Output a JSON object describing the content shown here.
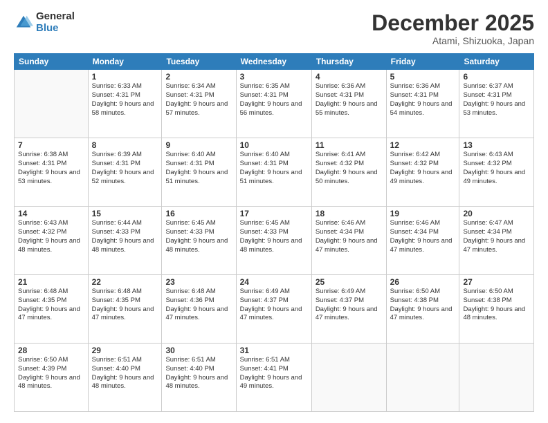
{
  "logo": {
    "general": "General",
    "blue": "Blue"
  },
  "title": "December 2025",
  "location": "Atami, Shizuoka, Japan",
  "days_of_week": [
    "Sunday",
    "Monday",
    "Tuesday",
    "Wednesday",
    "Thursday",
    "Friday",
    "Saturday"
  ],
  "weeks": [
    [
      {
        "day": "",
        "sunrise": "",
        "sunset": "",
        "daylight": ""
      },
      {
        "day": "1",
        "sunrise": "Sunrise: 6:33 AM",
        "sunset": "Sunset: 4:31 PM",
        "daylight": "Daylight: 9 hours and 58 minutes."
      },
      {
        "day": "2",
        "sunrise": "Sunrise: 6:34 AM",
        "sunset": "Sunset: 4:31 PM",
        "daylight": "Daylight: 9 hours and 57 minutes."
      },
      {
        "day": "3",
        "sunrise": "Sunrise: 6:35 AM",
        "sunset": "Sunset: 4:31 PM",
        "daylight": "Daylight: 9 hours and 56 minutes."
      },
      {
        "day": "4",
        "sunrise": "Sunrise: 6:36 AM",
        "sunset": "Sunset: 4:31 PM",
        "daylight": "Daylight: 9 hours and 55 minutes."
      },
      {
        "day": "5",
        "sunrise": "Sunrise: 6:36 AM",
        "sunset": "Sunset: 4:31 PM",
        "daylight": "Daylight: 9 hours and 54 minutes."
      },
      {
        "day": "6",
        "sunrise": "Sunrise: 6:37 AM",
        "sunset": "Sunset: 4:31 PM",
        "daylight": "Daylight: 9 hours and 53 minutes."
      }
    ],
    [
      {
        "day": "7",
        "sunrise": "Sunrise: 6:38 AM",
        "sunset": "Sunset: 4:31 PM",
        "daylight": "Daylight: 9 hours and 53 minutes."
      },
      {
        "day": "8",
        "sunrise": "Sunrise: 6:39 AM",
        "sunset": "Sunset: 4:31 PM",
        "daylight": "Daylight: 9 hours and 52 minutes."
      },
      {
        "day": "9",
        "sunrise": "Sunrise: 6:40 AM",
        "sunset": "Sunset: 4:31 PM",
        "daylight": "Daylight: 9 hours and 51 minutes."
      },
      {
        "day": "10",
        "sunrise": "Sunrise: 6:40 AM",
        "sunset": "Sunset: 4:31 PM",
        "daylight": "Daylight: 9 hours and 51 minutes."
      },
      {
        "day": "11",
        "sunrise": "Sunrise: 6:41 AM",
        "sunset": "Sunset: 4:32 PM",
        "daylight": "Daylight: 9 hours and 50 minutes."
      },
      {
        "day": "12",
        "sunrise": "Sunrise: 6:42 AM",
        "sunset": "Sunset: 4:32 PM",
        "daylight": "Daylight: 9 hours and 49 minutes."
      },
      {
        "day": "13",
        "sunrise": "Sunrise: 6:43 AM",
        "sunset": "Sunset: 4:32 PM",
        "daylight": "Daylight: 9 hours and 49 minutes."
      }
    ],
    [
      {
        "day": "14",
        "sunrise": "Sunrise: 6:43 AM",
        "sunset": "Sunset: 4:32 PM",
        "daylight": "Daylight: 9 hours and 48 minutes."
      },
      {
        "day": "15",
        "sunrise": "Sunrise: 6:44 AM",
        "sunset": "Sunset: 4:33 PM",
        "daylight": "Daylight: 9 hours and 48 minutes."
      },
      {
        "day": "16",
        "sunrise": "Sunrise: 6:45 AM",
        "sunset": "Sunset: 4:33 PM",
        "daylight": "Daylight: 9 hours and 48 minutes."
      },
      {
        "day": "17",
        "sunrise": "Sunrise: 6:45 AM",
        "sunset": "Sunset: 4:33 PM",
        "daylight": "Daylight: 9 hours and 48 minutes."
      },
      {
        "day": "18",
        "sunrise": "Sunrise: 6:46 AM",
        "sunset": "Sunset: 4:34 PM",
        "daylight": "Daylight: 9 hours and 47 minutes."
      },
      {
        "day": "19",
        "sunrise": "Sunrise: 6:46 AM",
        "sunset": "Sunset: 4:34 PM",
        "daylight": "Daylight: 9 hours and 47 minutes."
      },
      {
        "day": "20",
        "sunrise": "Sunrise: 6:47 AM",
        "sunset": "Sunset: 4:34 PM",
        "daylight": "Daylight: 9 hours and 47 minutes."
      }
    ],
    [
      {
        "day": "21",
        "sunrise": "Sunrise: 6:48 AM",
        "sunset": "Sunset: 4:35 PM",
        "daylight": "Daylight: 9 hours and 47 minutes."
      },
      {
        "day": "22",
        "sunrise": "Sunrise: 6:48 AM",
        "sunset": "Sunset: 4:35 PM",
        "daylight": "Daylight: 9 hours and 47 minutes."
      },
      {
        "day": "23",
        "sunrise": "Sunrise: 6:48 AM",
        "sunset": "Sunset: 4:36 PM",
        "daylight": "Daylight: 9 hours and 47 minutes."
      },
      {
        "day": "24",
        "sunrise": "Sunrise: 6:49 AM",
        "sunset": "Sunset: 4:37 PM",
        "daylight": "Daylight: 9 hours and 47 minutes."
      },
      {
        "day": "25",
        "sunrise": "Sunrise: 6:49 AM",
        "sunset": "Sunset: 4:37 PM",
        "daylight": "Daylight: 9 hours and 47 minutes."
      },
      {
        "day": "26",
        "sunrise": "Sunrise: 6:50 AM",
        "sunset": "Sunset: 4:38 PM",
        "daylight": "Daylight: 9 hours and 47 minutes."
      },
      {
        "day": "27",
        "sunrise": "Sunrise: 6:50 AM",
        "sunset": "Sunset: 4:38 PM",
        "daylight": "Daylight: 9 hours and 48 minutes."
      }
    ],
    [
      {
        "day": "28",
        "sunrise": "Sunrise: 6:50 AM",
        "sunset": "Sunset: 4:39 PM",
        "daylight": "Daylight: 9 hours and 48 minutes."
      },
      {
        "day": "29",
        "sunrise": "Sunrise: 6:51 AM",
        "sunset": "Sunset: 4:40 PM",
        "daylight": "Daylight: 9 hours and 48 minutes."
      },
      {
        "day": "30",
        "sunrise": "Sunrise: 6:51 AM",
        "sunset": "Sunset: 4:40 PM",
        "daylight": "Daylight: 9 hours and 48 minutes."
      },
      {
        "day": "31",
        "sunrise": "Sunrise: 6:51 AM",
        "sunset": "Sunset: 4:41 PM",
        "daylight": "Daylight: 9 hours and 49 minutes."
      },
      {
        "day": "",
        "sunrise": "",
        "sunset": "",
        "daylight": ""
      },
      {
        "day": "",
        "sunrise": "",
        "sunset": "",
        "daylight": ""
      },
      {
        "day": "",
        "sunrise": "",
        "sunset": "",
        "daylight": ""
      }
    ]
  ]
}
